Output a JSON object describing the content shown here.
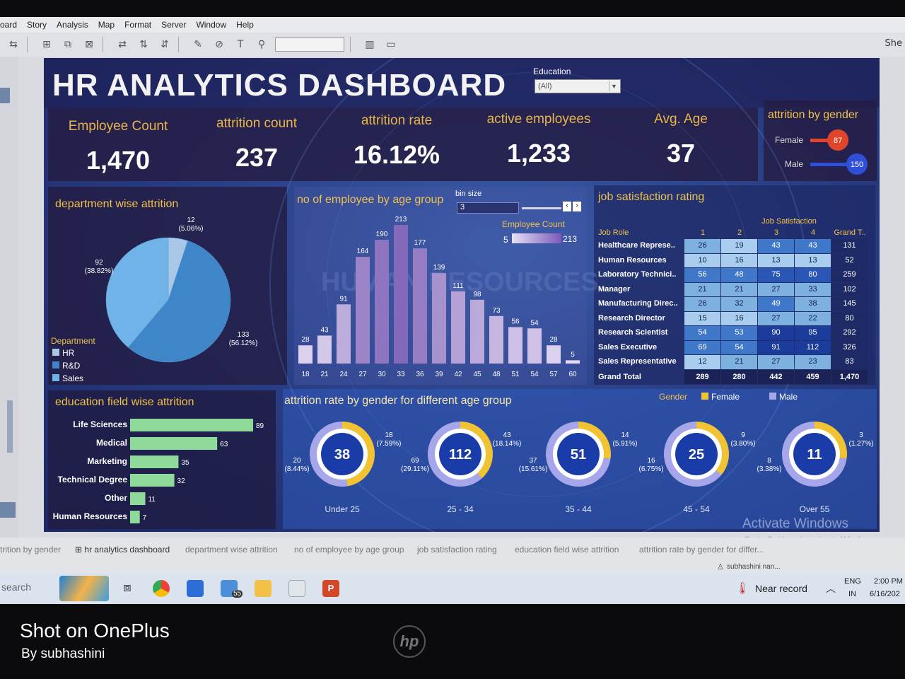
{
  "menu": [
    "oard",
    "Story",
    "Analysis",
    "Map",
    "Format",
    "Server",
    "Window",
    "Help"
  ],
  "toolbar_right": "She",
  "dashboard": {
    "title": "HR ANALYTICS DASHBOARD",
    "filter": {
      "label": "Education",
      "value": "(All)"
    }
  },
  "kpis": [
    {
      "label": "Employee Count",
      "value": "1,470"
    },
    {
      "label": "attrition count",
      "value": "237"
    },
    {
      "label": "attrition rate",
      "value": "16.12%"
    },
    {
      "label": "active employees",
      "value": "1,233"
    },
    {
      "label": "Avg. Age",
      "value": "37"
    }
  ],
  "gender_panel": {
    "title": "attrition by gender",
    "bars": [
      {
        "label": "Female",
        "value": 87,
        "value_text": "87",
        "color": "#e0452c"
      },
      {
        "label": "Male",
        "value": 150,
        "value_text": "150",
        "color": "#2f4fd6"
      }
    ]
  },
  "department_panel": {
    "title": "department wise attrition",
    "legend_title": "Department",
    "legend": [
      {
        "label": "HR",
        "color": "#a9c7e6"
      },
      {
        "label": "R&D",
        "color": "#3f86c8"
      },
      {
        "label": "Sales",
        "color": "#6fb3e8"
      }
    ],
    "labels": [
      {
        "value": "12",
        "pct": "(5.06%)"
      },
      {
        "value": "92",
        "pct": "(38.82%)"
      },
      {
        "value": "133",
        "pct": "(56.12%)"
      }
    ]
  },
  "age_panel": {
    "title": "no of employee by age group",
    "bin_label": "bin size",
    "bin_value": "3",
    "legend_title": "Employee Count",
    "legend_min": "5",
    "legend_max": "213",
    "watermark": "HUMAN RESOURCES"
  },
  "job_panel": {
    "title": "job satisfaction rating",
    "col_group": "Job Satisfaction",
    "row_header": "Job Role",
    "columns": [
      "1",
      "2",
      "3",
      "4",
      "Grand T.."
    ],
    "rows": [
      {
        "role": "Healthcare Represe..",
        "v": [
          "26",
          "19",
          "43",
          "43",
          "131"
        ]
      },
      {
        "role": "Human Resources",
        "v": [
          "10",
          "16",
          "13",
          "13",
          "52"
        ]
      },
      {
        "role": "Laboratory Technici..",
        "v": [
          "56",
          "48",
          "75",
          "80",
          "259"
        ]
      },
      {
        "role": "Manager",
        "v": [
          "21",
          "21",
          "27",
          "33",
          "102"
        ]
      },
      {
        "role": "Manufacturing Direc..",
        "v": [
          "26",
          "32",
          "49",
          "38",
          "145"
        ]
      },
      {
        "role": "Research Director",
        "v": [
          "15",
          "16",
          "27",
          "22",
          "80"
        ]
      },
      {
        "role": "Research Scientist",
        "v": [
          "54",
          "53",
          "90",
          "95",
          "292"
        ]
      },
      {
        "role": "Sales Executive",
        "v": [
          "69",
          "54",
          "91",
          "112",
          "326"
        ]
      },
      {
        "role": "Sales Representative",
        "v": [
          "12",
          "21",
          "27",
          "23",
          "83"
        ]
      }
    ],
    "total": {
      "role": "Grand Total",
      "v": [
        "289",
        "280",
        "442",
        "459",
        "1,470"
      ]
    }
  },
  "education_panel": {
    "title": "education field wise attrition"
  },
  "donut_panel": {
    "title": "attrition rate by gender for different age group",
    "legend_title": "Gender",
    "legend": [
      {
        "label": "Female",
        "color": "#f1c232"
      },
      {
        "label": "Male",
        "color": "#a7a6ea"
      }
    ],
    "groups": [
      {
        "label": "Under 25",
        "total": "38",
        "female": 18,
        "male": 20,
        "female_text": "18",
        "female_pct": "(7.59%)",
        "male_text": "20",
        "male_pct": "(8.44%)"
      },
      {
        "label": "25 - 34",
        "total": "112",
        "female": 43,
        "male": 69,
        "female_text": "43",
        "female_pct": "(18.14%)",
        "male_text": "69",
        "male_pct": "(29.11%)"
      },
      {
        "label": "35 - 44",
        "total": "51",
        "female": 14,
        "male": 37,
        "female_text": "14",
        "female_pct": "(5.91%)",
        "male_text": "37",
        "male_pct": "(15.61%)"
      },
      {
        "label": "45 - 54",
        "total": "25",
        "female": 9,
        "male": 16,
        "female_text": "9",
        "female_pct": "(3.80%)",
        "male_text": "16",
        "male_pct": "(6.75%)"
      },
      {
        "label": "Over 55",
        "total": "11",
        "female": 3,
        "male": 8,
        "female_text": "3",
        "female_pct": "(1.27%)",
        "male_text": "8",
        "male_pct": "(3.38%)"
      }
    ]
  },
  "activate": {
    "line1": "Activate Windows",
    "line2": "Go to Settings to activate Windows."
  },
  "tabs": [
    "trition by gender",
    "⊞ hr analytics dashboard",
    "department wise attrition",
    "no of employee by age group",
    "job satisfaction rating",
    "education field wise attrition",
    "attrition rate by gender for differ..."
  ],
  "user": "subhashini nan...",
  "taskbar": {
    "search": "search",
    "weather": "Near record",
    "lang1": "ENG",
    "lang2": "IN",
    "time": "2:00 PM",
    "date": "6/16/202",
    "mail_badge": "55"
  },
  "photo": {
    "line1": "Shot on OnePlus",
    "line2": "By subhashini"
  },
  "chart_data": [
    {
      "type": "pie",
      "categories": [
        "HR",
        "R&D",
        "Sales"
      ],
      "values": [
        12,
        133,
        92
      ],
      "labels": [
        "12 (5.06%)",
        "133 (56.12%)",
        "92 (38.82%)"
      ],
      "legend": "Department"
    },
    {
      "type": "bar",
      "title": "no of employee by age group",
      "categories": [
        "18",
        "21",
        "24",
        "27",
        "30",
        "33",
        "36",
        "39",
        "42",
        "45",
        "48",
        "51",
        "54",
        "57",
        "60"
      ],
      "values": [
        28,
        43,
        91,
        164,
        190,
        213,
        177,
        139,
        111,
        98,
        73,
        56,
        54,
        28,
        5
      ]
    },
    {
      "type": "bar",
      "title": "education field wise attrition",
      "categories": [
        "Life Sciences",
        "Medical",
        "Marketing",
        "Technical Degree",
        "Other",
        "Human Resources"
      ],
      "values": [
        89,
        63,
        35,
        32,
        11,
        7
      ]
    },
    {
      "type": "bar",
      "title": "attrition by gender",
      "categories": [
        "Female",
        "Male"
      ],
      "values": [
        87,
        150
      ]
    },
    {
      "type": "pie",
      "title": "attrition rate by gender for different age group",
      "categories": [
        "Under 25",
        "25 - 34",
        "35 - 44",
        "45 - 54",
        "Over 55"
      ],
      "series": [
        {
          "name": "Female",
          "values": [
            18,
            43,
            14,
            9,
            3
          ]
        },
        {
          "name": "Male",
          "values": [
            20,
            69,
            37,
            16,
            8
          ]
        }
      ]
    }
  ]
}
